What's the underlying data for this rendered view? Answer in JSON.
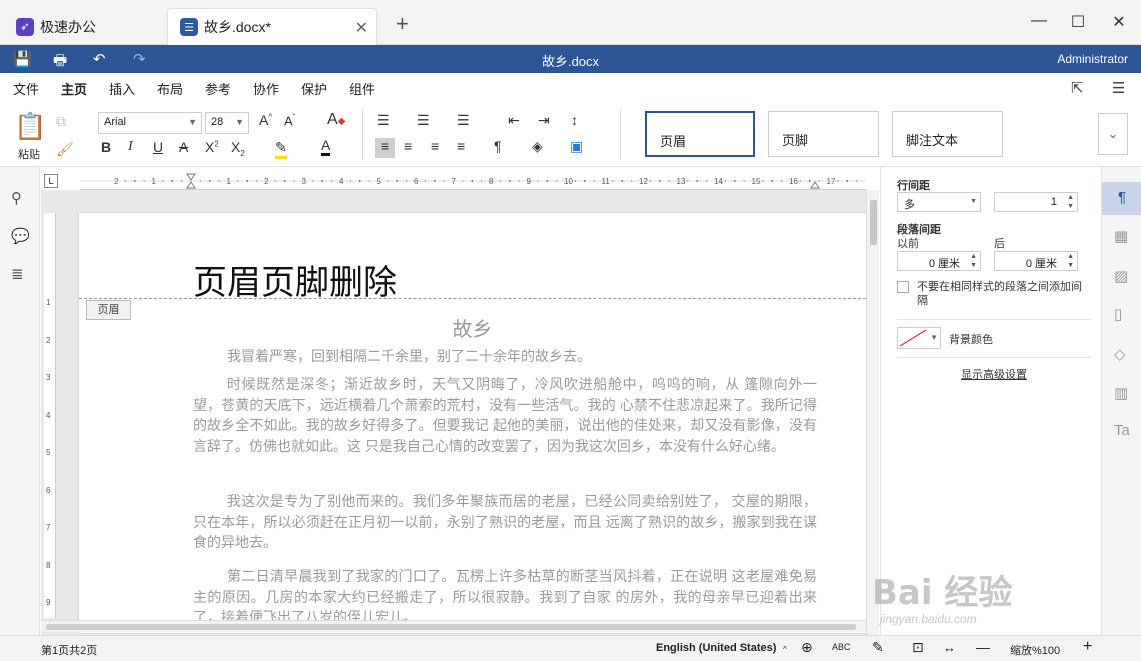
{
  "tabs": [
    {
      "label": "极速办公",
      "icon": "rocket-icon"
    },
    {
      "label": "故乡.docx*",
      "icon": "document-icon"
    }
  ],
  "window": {
    "title": "故乡.docx",
    "user": "Administrator"
  },
  "menu": {
    "items": [
      "文件",
      "主页",
      "插入",
      "布局",
      "参考",
      "协作",
      "保护",
      "组件"
    ],
    "active": "主页"
  },
  "ribbon": {
    "paste_label": "粘贴",
    "font_name": "Arial",
    "font_size": "28",
    "styles": [
      "页眉",
      "页脚",
      "脚注文本"
    ]
  },
  "document": {
    "header_text": "页眉页脚删除",
    "header_tag": "页眉",
    "title": "故乡",
    "paragraphs": [
      "我冒着严寒，回到相隔二千余里，别了二十余年的故乡去。",
      "时候既然是深冬；渐近故乡时，天气又阴晦了，冷风吹进船舱中，呜呜的响，从 篷隙向外一望，苍黄的天底下，远近横着几个萧索的荒村，没有一些活气。我的 心禁不住悲凉起来了。我所记得的故乡全不如此。我的故乡好得多了。但要我记 起他的美丽，说出他的佳处来，却又没有影像，没有言辞了。仿佛也就如此。这 只是我自己心情的改变罢了，因为我这次回乡，本没有什么好心绪。",
      "我这次是专为了别他而来的。我们多年聚族而居的老屋，已经公同卖给别姓了， 交屋的期限，只在本年，所以必须赶在正月初一以前，永别了熟识的老屋，而且 远离了熟识的故乡，搬家到我在谋食的异地去。",
      "第二日清早晨我到了我家的门口了。瓦楞上许多枯草的断茎当风抖着，正在说明 这老屋难免易主的原因。几房的本家大约已经搬走了，所以很寂静。我到了自家 的房外，我的母亲早已迎着出来了，接着便飞出了八岁的侄儿宏儿。"
    ]
  },
  "panel": {
    "line_spacing_label": "行间距",
    "line_spacing_mode": "多",
    "line_spacing_value": "1",
    "para_spacing_label": "段落间距",
    "before_label": "以前",
    "after_label": "后",
    "before_value": "0 厘米",
    "after_value": "0 厘米",
    "checkbox_label": "不要在相同样式的段落之间添加间隔",
    "bg_color_label": "背景颜色",
    "advanced_link": "显示高级设置"
  },
  "status": {
    "page_info": "第1页共2页",
    "language": "English (United States)",
    "zoom": "缩放%100"
  },
  "watermark": {
    "logo": "Bai 经验",
    "sub": "jingyan.baidu.com"
  },
  "colors": {
    "accent": "#2b5597",
    "tab_bg": "#f3f3f3"
  }
}
